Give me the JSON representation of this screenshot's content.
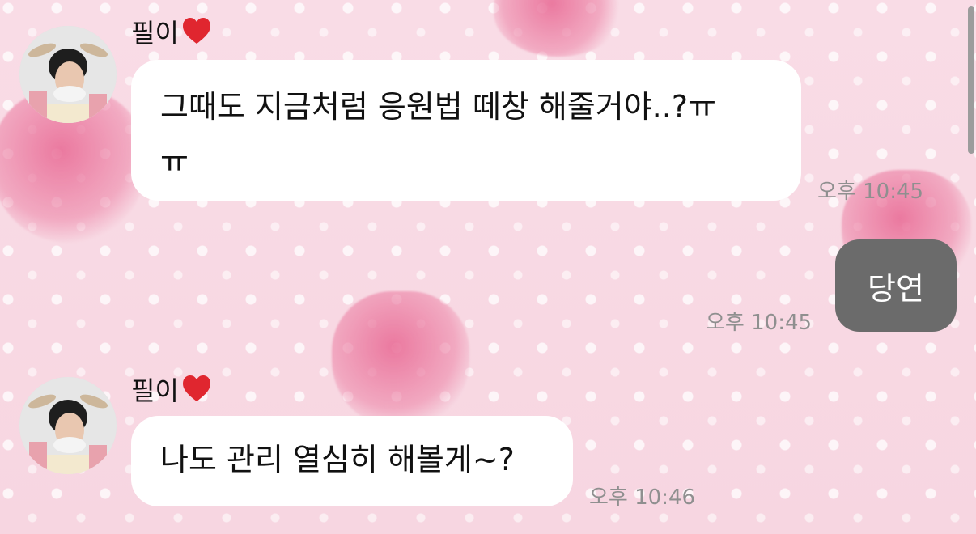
{
  "messages": [
    {
      "sender": "필이",
      "sender_emoji": "❤️",
      "text_line1": "그때도 지금처럼 응원법 떼창 해줄거야..?ㅠ",
      "text_line2": "ㅠ",
      "time": "오후 10:45"
    },
    {
      "sender": "me",
      "text": "당연",
      "time": "오후 10:45"
    },
    {
      "sender": "필이",
      "sender_emoji": "❤️",
      "text": "나도 관리 열심히 해볼게~?",
      "time": "오후 10:46"
    }
  ],
  "colors": {
    "background": "#f9dbe5",
    "incoming_bubble": "#ffffff",
    "outgoing_bubble": "#6b6b6b",
    "timestamp": "#8f8f8f",
    "heart": "#e0262f"
  },
  "icons": {
    "heart": "heart-icon",
    "avatar": "profile-avatar"
  }
}
